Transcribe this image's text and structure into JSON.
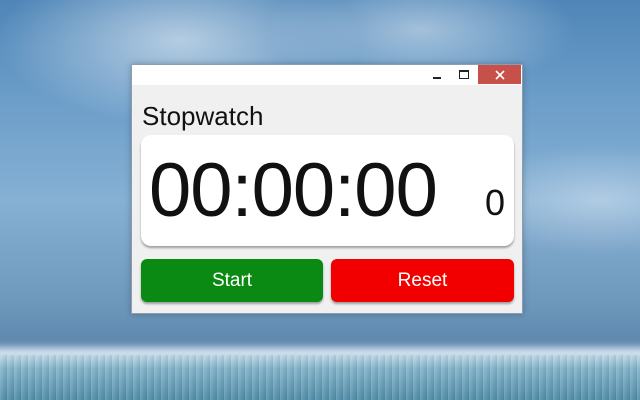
{
  "window": {
    "title": "Stopwatch",
    "controls": {
      "minimize": "minimize-icon",
      "maximize": "maximize-icon",
      "close": "close-icon"
    }
  },
  "display": {
    "time": "00:00:00",
    "sub": "0"
  },
  "buttons": {
    "start_label": "Start",
    "reset_label": "Reset"
  },
  "colors": {
    "start": "#0a8a12",
    "reset": "#f20000",
    "close": "#c7504b"
  }
}
